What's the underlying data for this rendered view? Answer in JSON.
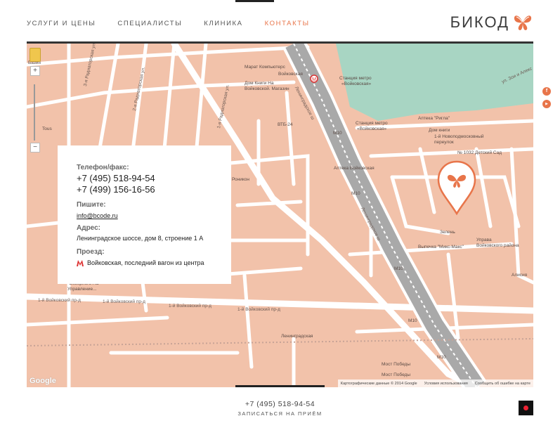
{
  "nav": {
    "items": [
      {
        "label": "УСЛУГИ И ЦЕНЫ"
      },
      {
        "label": "СПЕЦИАЛИСТЫ"
      },
      {
        "label": "КЛИНИКА"
      },
      {
        "label": "КОНТАКТЫ"
      }
    ],
    "active_index": 3
  },
  "logo": {
    "text": "БИКОД",
    "icon": "butterfly-icon"
  },
  "colors": {
    "accent": "#e8754a",
    "map_bg": "#f2c2aa",
    "road": "#ffffff",
    "park": "#a8d5c3"
  },
  "card": {
    "phone_label": "Телефон/факс:",
    "phone_1": "+7 (495) 518-94-54",
    "phone_2": "+7 (499) 156-16-56",
    "write_label": "Пишите:",
    "email": "info@bcode.ru",
    "address_label": "Адрес:",
    "address": "Ленинградское шоссе, дом 8, строение 1 А",
    "route_label": "Проезд:",
    "route": "Войковская, последний вагон из центра",
    "route_icon": "metro-m-icon"
  },
  "map": {
    "labels": {
      "marat": "Марат Компьютерс",
      "voykovskaya": "Войковская",
      "dom_knigi": "Дом Книги На",
      "dom_knigi2": "Войковской. Магазин",
      "metro_station": "Станция метро",
      "metro_station_name": "«Войковская»",
      "metro_station2": "Станция метро",
      "metro_station2_name": "«Войковская»",
      "apteka_rigla": "Аптека \"Ригла\"",
      "dom_knigi3": "Дом книги",
      "novopodmoskovny": "1-й Новоподмосковный",
      "pereulok": "переулок",
      "detsky_sad": "№ 1032 Детский Сад",
      "vtb": "ВТБ-24",
      "apteka_voykovskaya": "Аптека Войковская",
      "ronikon": "Роникон",
      "zelen": "Зелень",
      "vypechka": "Выпечка \"Микс-Макс\"",
      "uprava": "Управа",
      "uprava2": "Войковского района",
      "alisia": "Алисия",
      "severny_ao": "Северного АО",
      "upravlenie": "Управление...",
      "leningradskaya": "Ленинградская",
      "most_pobedy": "Мост Победы",
      "most_pobedy2": "Мост Победы",
      "leningradskoe_sh1": "Ленинградское ш",
      "leningradskoe_sh2": "Ленинградское ш",
      "voykovsky_1": "1-й Войковский пр-д",
      "voykovsky_2": "1-й Войковский пр-д",
      "voykovsky_3": "1-й Войковский пр-д",
      "voykovsky_4": "1-й Войковский пр-д",
      "radiatorskaya1": "3-я Радиаторская ул.",
      "radiatorskaya2": "2-я Радиаторская ул.",
      "radiatorskaya3": "1-я Радиаторская ул.",
      "zoi": "ул. Зои и Алекс",
      "m10_1": "М10",
      "m10_2": "М10",
      "m10_3": "М10",
      "m10_4": "М10",
      "m10_5": "М10",
      "tous": "Tous",
      "bazin": "Базин"
    },
    "footer": {
      "data": "Картографические данные © 2014 Google",
      "terms": "Условия использования",
      "report": "Сообщить об ошибке на карте"
    },
    "google": "Google",
    "zoom_in": "+",
    "zoom_out": "−"
  },
  "social": [
    {
      "icon": "facebook-icon",
      "glyph": "f"
    },
    {
      "icon": "youtube-icon",
      "glyph": "▶"
    }
  ],
  "footer": {
    "phone": "+7 (495) 518-94-54",
    "cta": "ЗАПИСАТЬСЯ НА ПРИЁМ"
  }
}
